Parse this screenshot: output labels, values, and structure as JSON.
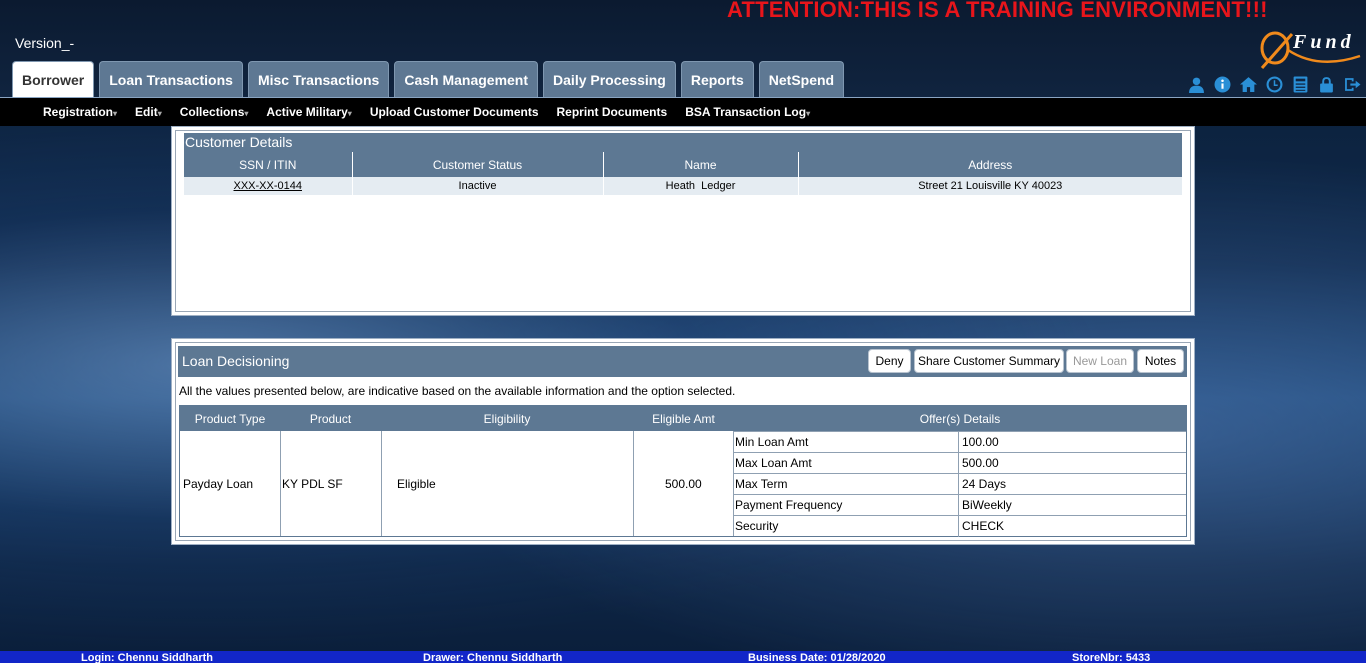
{
  "banner": "ATTENTION:THIS IS A TRAINING ENVIRONMENT!!!",
  "version": "Version_-",
  "logo": {
    "text": "Fund"
  },
  "tabs": [
    {
      "label": "Borrower",
      "active": true
    },
    {
      "label": "Loan Transactions"
    },
    {
      "label": "Misc Transactions"
    },
    {
      "label": "Cash Management"
    },
    {
      "label": "Daily Processing"
    },
    {
      "label": "Reports"
    },
    {
      "label": "NetSpend"
    }
  ],
  "header_icons": [
    "user-icon",
    "info-icon",
    "home-icon",
    "clock-icon",
    "calculator-icon",
    "lock-icon",
    "logout-icon"
  ],
  "submenu": [
    {
      "label": "Registration",
      "has_dropdown": true
    },
    {
      "label": "Edit",
      "has_dropdown": true
    },
    {
      "label": "Collections",
      "has_dropdown": true
    },
    {
      "label": "Active Military",
      "has_dropdown": true
    },
    {
      "label": "Upload Customer Documents"
    },
    {
      "label": "Reprint Documents"
    },
    {
      "label": "BSA Transaction Log",
      "has_dropdown": true
    }
  ],
  "customer_details": {
    "title": "Customer Details",
    "columns": [
      "SSN / ITIN",
      "Customer Status",
      "Name",
      "Address"
    ],
    "row": {
      "ssn": "XXX-XX-0144",
      "status": "Inactive",
      "name": "Heath  Ledger",
      "address": "Street 21 Louisville KY 40023"
    }
  },
  "loan_decisioning": {
    "title": "Loan Decisioning",
    "buttons": {
      "deny": "Deny",
      "share": "Share Customer Summary",
      "new_loan": "New Loan",
      "notes": "Notes"
    },
    "note": "All the values presented below, are indicative based on the available information and the option selected.",
    "columns": [
      "Product Type",
      "Product",
      "Eligibility",
      "Eligible Amt",
      "Offer(s) Details"
    ],
    "row": {
      "product_type": "Payday Loan",
      "product": "KY PDL SF",
      "eligibility": "Eligible",
      "eligible_amt": "500.00"
    },
    "offers": [
      {
        "label": "Min Loan Amt",
        "value": "100.00"
      },
      {
        "label": "Max Loan Amt",
        "value": "500.00"
      },
      {
        "label": "Max Term",
        "value": "24 Days"
      },
      {
        "label": "Payment Frequency",
        "value": "BiWeekly"
      },
      {
        "label": "Security",
        "value": "CHECK"
      }
    ]
  },
  "footer": {
    "login": "Login: Chennu Siddharth",
    "drawer": "Drawer: Chennu Siddharth",
    "business_date": "Business Date: 01/28/2020",
    "store": "StoreNbr: 5433"
  },
  "colors": {
    "header_bar": "#5d7893",
    "banner": "#e8151b",
    "footer": "#1226c8",
    "icons": "#2a8fd6"
  }
}
